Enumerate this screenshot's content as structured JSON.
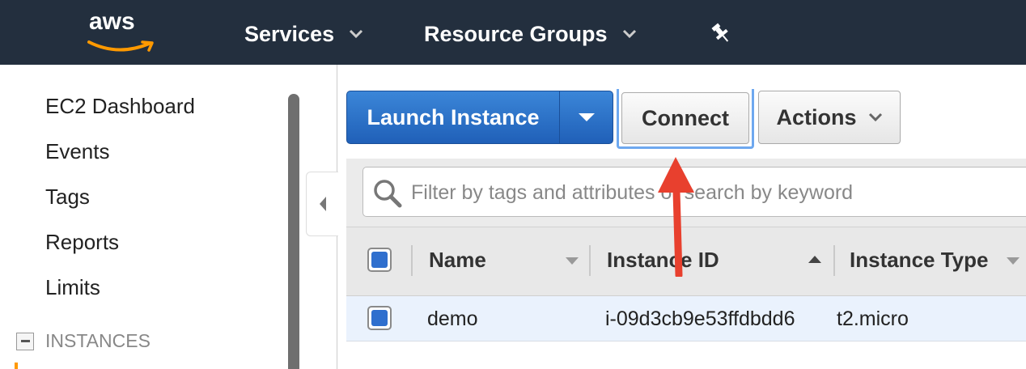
{
  "header": {
    "logo_text": "aws",
    "nav": [
      {
        "label": "Services"
      },
      {
        "label": "Resource Groups"
      }
    ]
  },
  "sidebar": {
    "items": [
      {
        "label": "EC2 Dashboard"
      },
      {
        "label": "Events"
      },
      {
        "label": "Tags"
      },
      {
        "label": "Reports"
      },
      {
        "label": "Limits"
      }
    ],
    "section": {
      "label": "INSTANCES"
    }
  },
  "toolbar": {
    "launch_label": "Launch Instance",
    "connect_label": "Connect",
    "actions_label": "Actions"
  },
  "filter": {
    "placeholder": "Filter by tags and attributes or search by keyword",
    "value": ""
  },
  "table": {
    "columns": [
      "Name",
      "Instance ID",
      "Instance Type"
    ],
    "rows": [
      {
        "name": "demo",
        "instance_id": "i-09d3cb9e53ffdbdd6",
        "instance_type": "t2.micro",
        "selected": true
      }
    ]
  },
  "colors": {
    "header_bg": "#232f3e",
    "primary_button": "#2a6fcc",
    "annotation_arrow": "#e8402e",
    "selected_row": "#eaf2fd"
  }
}
